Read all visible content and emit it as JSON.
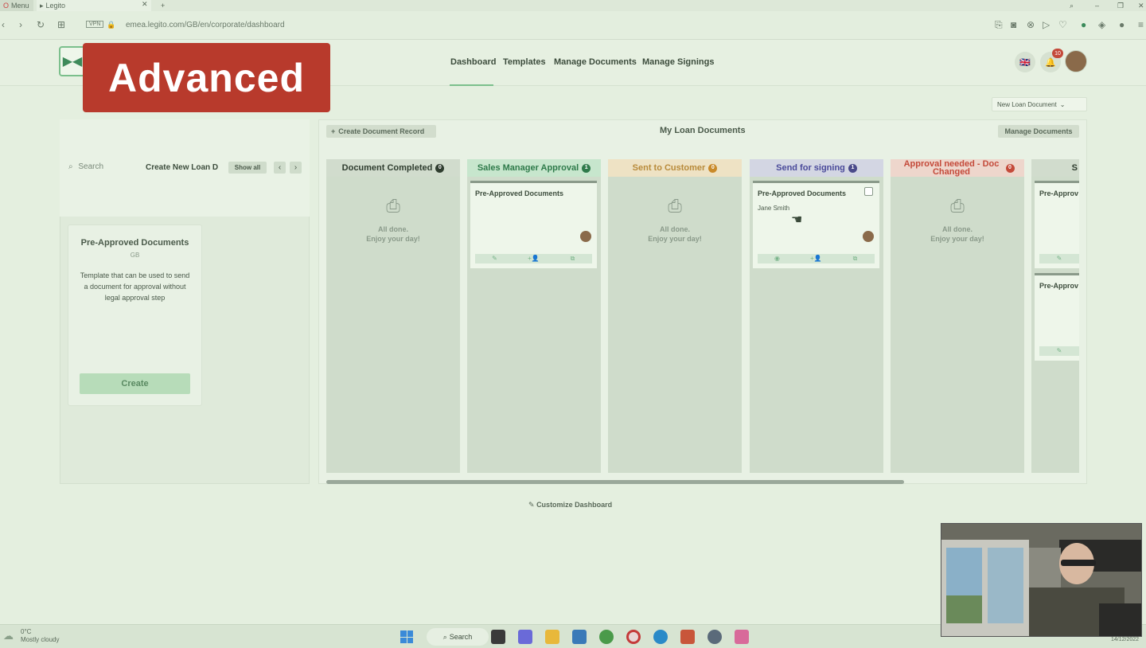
{
  "browser": {
    "menu_tab": "Menu",
    "active_tab": "Legito",
    "url": "emea.legito.com/GB/en/corporate/dashboard",
    "vpn_label": "VPN"
  },
  "overlay_badge": "Advanced",
  "header": {
    "nav": [
      "Dashboard",
      "Templates",
      "Manage Documents",
      "Manage Signings"
    ],
    "active_nav": "Dashboard",
    "notification_count": "10",
    "language_flag": "🇬🇧"
  },
  "doc_type_select": "New Loan Document",
  "left_panel": {
    "search_placeholder": "Search",
    "create_label": "Create New Loan D",
    "show_all": "Show all",
    "template": {
      "title": "Pre-Approved Documents",
      "subtitle": "GB",
      "description": "Template that can be used to send a document for approval without legal approval step",
      "create_button": "Create"
    }
  },
  "board": {
    "create_record": "Create Document Record",
    "title": "My Loan Documents",
    "manage_documents": "Manage Documents",
    "empty_line1": "All done.",
    "empty_line2": "Enjoy your day!",
    "columns": [
      {
        "name": "Document Completed",
        "count": "0",
        "color": "#d1dccd",
        "text_color": "#2f3d2f",
        "count_color": "#2f3d2f"
      },
      {
        "name": "Sales Manager Approval",
        "count": "1",
        "color": "#c7e6cd",
        "text_color": "#2e7a4a",
        "count_color": "#2e7a4a"
      },
      {
        "name": "Sent to Customer",
        "count": "0",
        "color": "#eee2c4",
        "text_color": "#b88a3a",
        "count_color": "#c98a2a"
      },
      {
        "name": "Send for signing",
        "count": "1",
        "color": "#d3d6e3",
        "text_color": "#4a4a9a",
        "count_color": "#4a4a8a"
      },
      {
        "name": "Approval needed - Doc Changed",
        "count": "0",
        "color": "#eed6cc",
        "text_color": "#c44a3a",
        "count_color": "#c44a3a"
      },
      {
        "name": "S",
        "count": "",
        "color": "#d1dccd",
        "text_color": "#2f3d2f",
        "count_color": "#2f3d2f"
      }
    ],
    "cards": {
      "sales_manager": {
        "title": "Pre-Approved Documents"
      },
      "send_for_signing": {
        "title": "Pre-Approved Documents",
        "assignee": "Jane Smith"
      },
      "partial_1": {
        "title": "Pre-Approv"
      },
      "partial_2": {
        "title": "Pre-Approv"
      }
    },
    "customize": "Customize Dashboard"
  },
  "taskbar": {
    "temperature": "0°C",
    "weather": "Mostly cloudy",
    "search": "Search",
    "date": "14/12/2022"
  },
  "colors": {
    "accent_green": "#7bbf8c",
    "badge_red": "#b83a2c",
    "page_bg": "#e4efdf"
  }
}
